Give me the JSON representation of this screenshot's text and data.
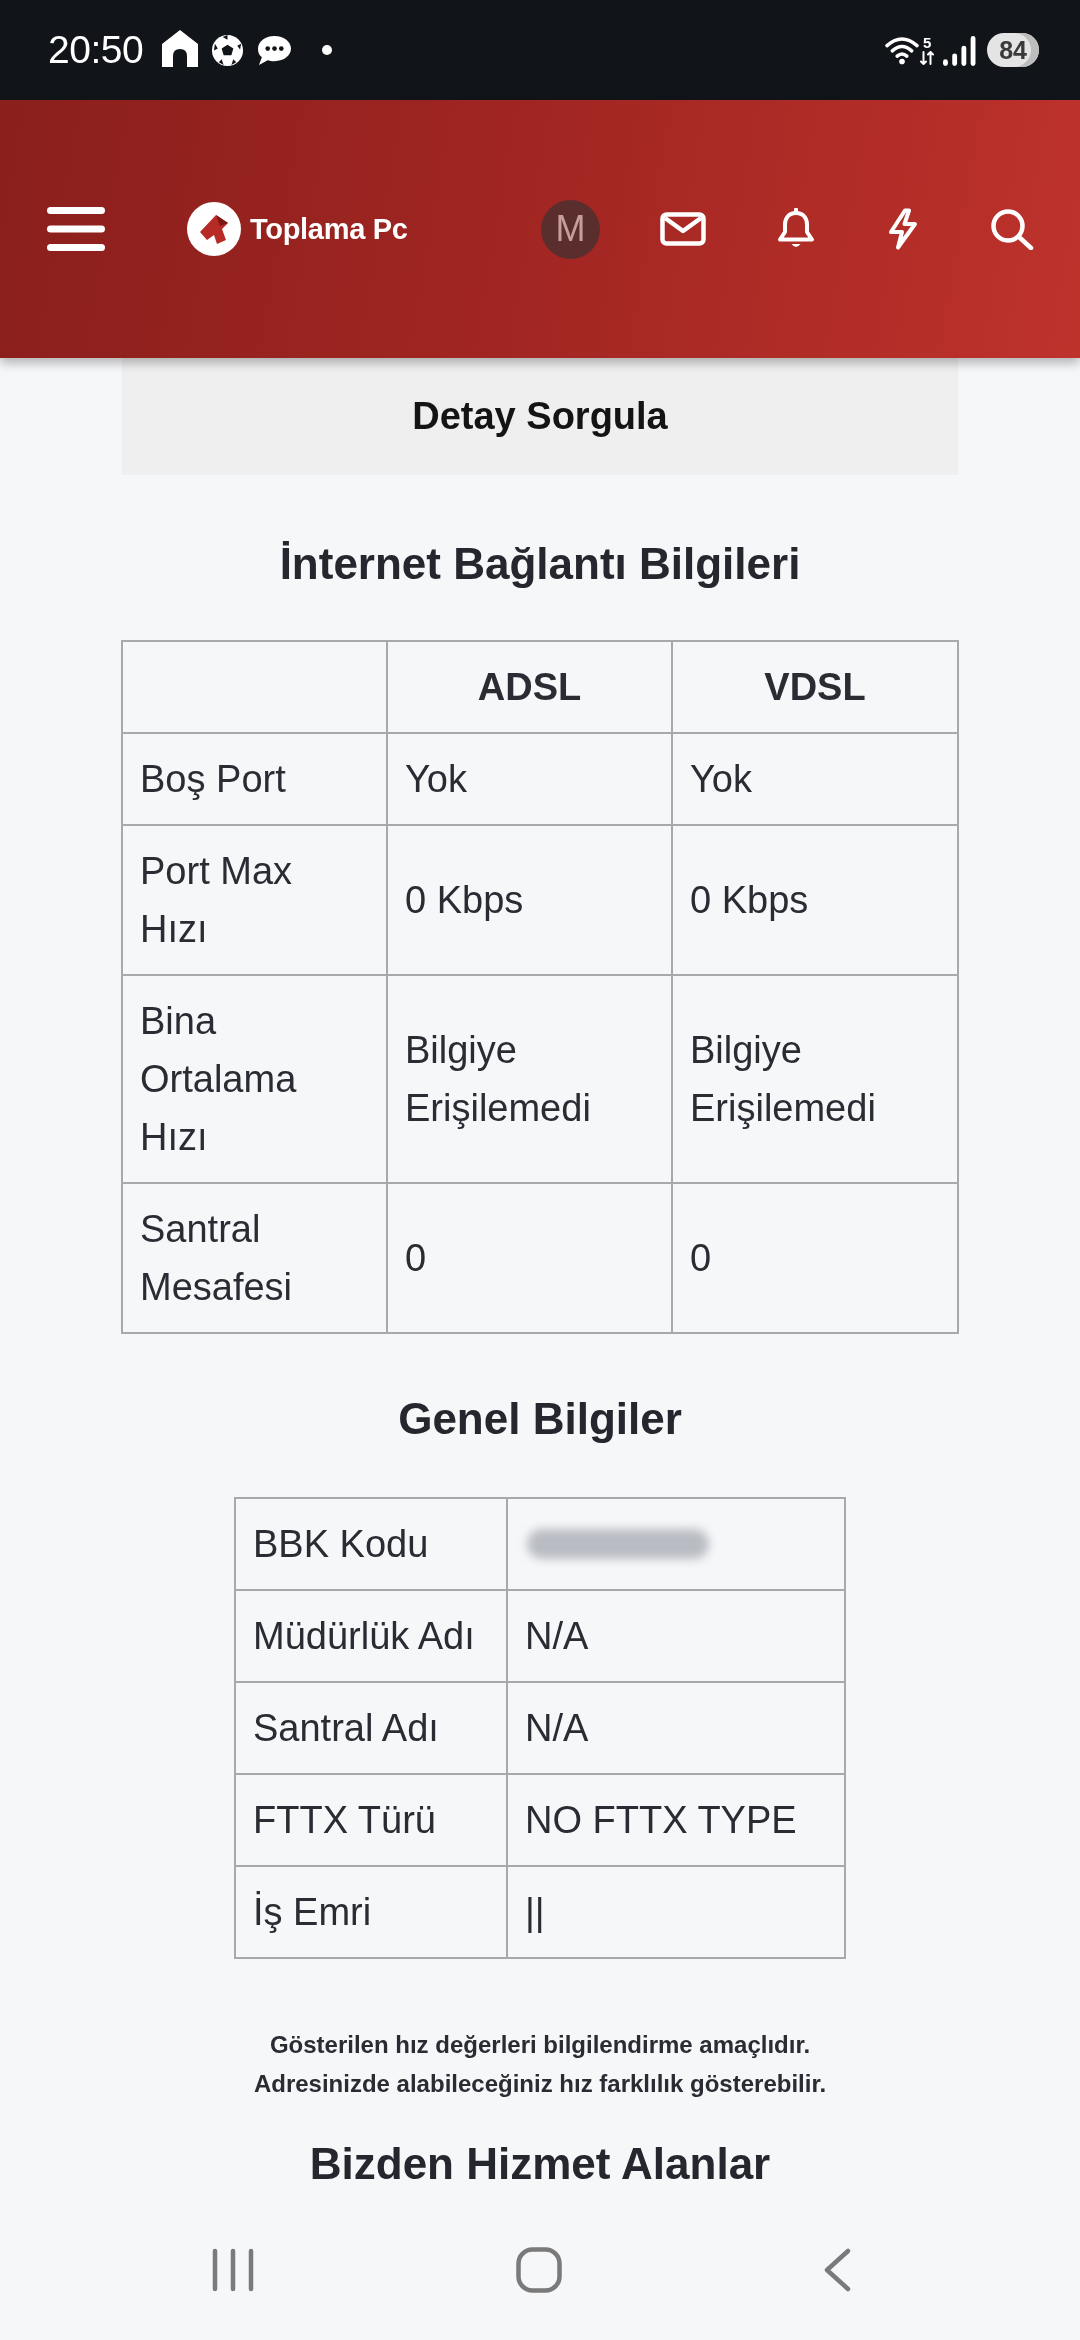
{
  "status_bar": {
    "time": "20:50",
    "wifi_label": "5",
    "battery": "84"
  },
  "header": {
    "logo_text": "Toplama Pc",
    "avatar_initial": "M"
  },
  "detail_button": {
    "label": "Detay Sorgula"
  },
  "connection_section": {
    "title": "İnternet Bağlantı Bilgileri",
    "columns": [
      "ADSL",
      "VDSL"
    ],
    "rows": [
      {
        "label": "Boş Port",
        "values": [
          "Yok",
          "Yok"
        ]
      },
      {
        "label": "Port Max Hızı",
        "values": [
          "0 Kbps",
          "0 Kbps"
        ]
      },
      {
        "label": "Bina Ortalama Hızı",
        "values": [
          "Bilgiye Erişilemedi",
          "Bilgiye Erişilemedi"
        ]
      },
      {
        "label": "Santral Mesafesi",
        "values": [
          "0",
          "0"
        ]
      }
    ]
  },
  "general_section": {
    "title": "Genel Bilgiler",
    "rows": [
      {
        "label": "BBK Kodu",
        "redacted": true
      },
      {
        "label": "Müdürlük Adı",
        "value": "N/A",
        "redacted": false
      },
      {
        "label": "Santral Adı",
        "value": "N/A",
        "redacted": false
      },
      {
        "label": "FTTX Türü",
        "value": "NO FTTX TYPE",
        "redacted": false
      },
      {
        "label": "İş Emri",
        "value": "||",
        "redacted": false
      }
    ]
  },
  "disclaimer": [
    "Gösterilen hız değerleri bilgilendirme amaçlıdır.",
    "Adresinizde alabileceğiniz hız farklılık gösterebilir."
  ],
  "next_section": {
    "title": "Bizden Hizmet Alanlar"
  }
}
